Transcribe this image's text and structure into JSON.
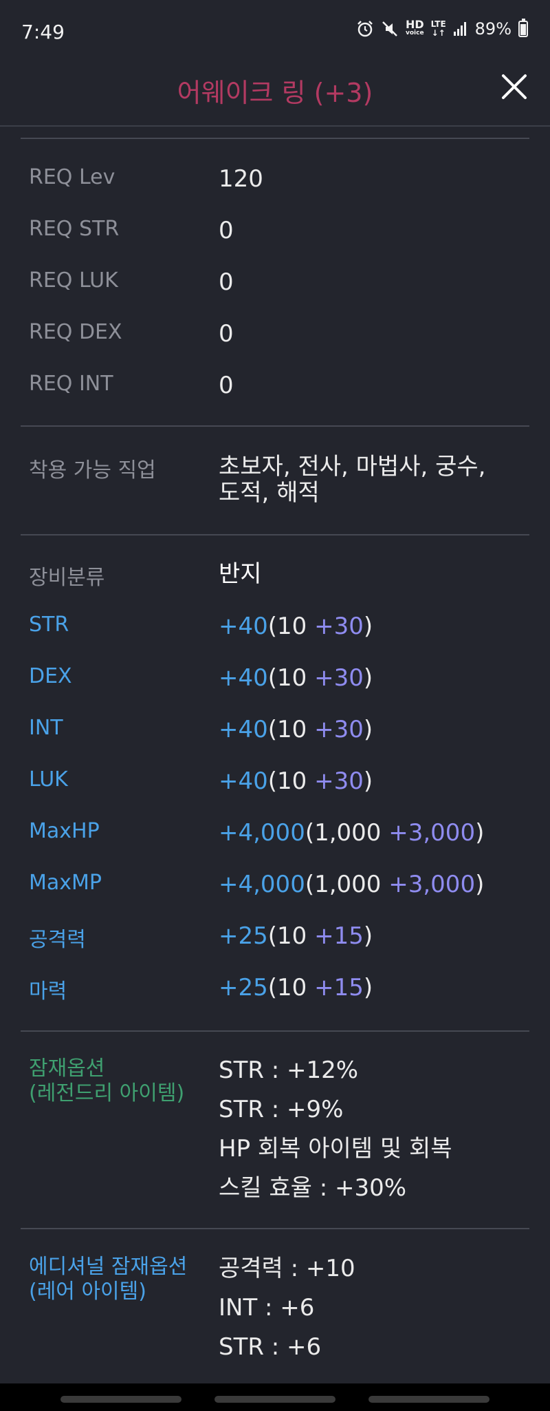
{
  "status": {
    "time": "7:49",
    "hd_label": "HD",
    "voice_label": "voice",
    "lte_label": "LTE",
    "battery_percent": "89%"
  },
  "header": {
    "title": "어웨이크 링 (+3)"
  },
  "requirements": [
    {
      "label": "REQ Lev",
      "value": "120"
    },
    {
      "label": "REQ STR",
      "value": "0"
    },
    {
      "label": "REQ LUK",
      "value": "0"
    },
    {
      "label": "REQ DEX",
      "value": "0"
    },
    {
      "label": "REQ INT",
      "value": "0"
    }
  ],
  "jobs": {
    "label": "착용 가능 직업",
    "line1": "초보자, 전사, 마법사, 궁수,",
    "line2": "도적, 해적"
  },
  "category": {
    "label": "장비분류",
    "value": "반지"
  },
  "stats": [
    {
      "label": "STR",
      "total": "+40",
      "base": "10",
      "bonus": "+30"
    },
    {
      "label": "DEX",
      "total": "+40",
      "base": "10",
      "bonus": "+30"
    },
    {
      "label": "INT",
      "total": "+40",
      "base": "10",
      "bonus": "+30"
    },
    {
      "label": "LUK",
      "total": "+40",
      "base": "10",
      "bonus": "+30"
    },
    {
      "label": "MaxHP",
      "total": "+4,000",
      "base": "1,000",
      "bonus": "+3,000"
    },
    {
      "label": "MaxMP",
      "total": "+4,000",
      "base": "1,000",
      "bonus": "+3,000"
    },
    {
      "label": "공격력",
      "total": "+25",
      "base": "10",
      "bonus": "+15"
    },
    {
      "label": "마력",
      "total": "+25",
      "base": "10",
      "bonus": "+15"
    }
  ],
  "potential": {
    "label_line1": "잠재옵션",
    "label_line2": "(레전드리 아이템)",
    "lines": [
      "STR : +12%",
      "STR : +9%",
      "HP 회복 아이템 및 회복",
      "스킬 효율 : +30%"
    ]
  },
  "additional": {
    "label_line1": "에디셔널 잠재옵션",
    "label_line2": "(레어 아이템)",
    "lines": [
      "공격력 : +10",
      "INT : +6",
      "STR : +6"
    ]
  },
  "colors": {
    "background": "#23252d",
    "title": "#b33a62",
    "stat_label": "#4aa2e8",
    "potential_label": "#3fa070",
    "bonus": "#8f8cf0"
  }
}
